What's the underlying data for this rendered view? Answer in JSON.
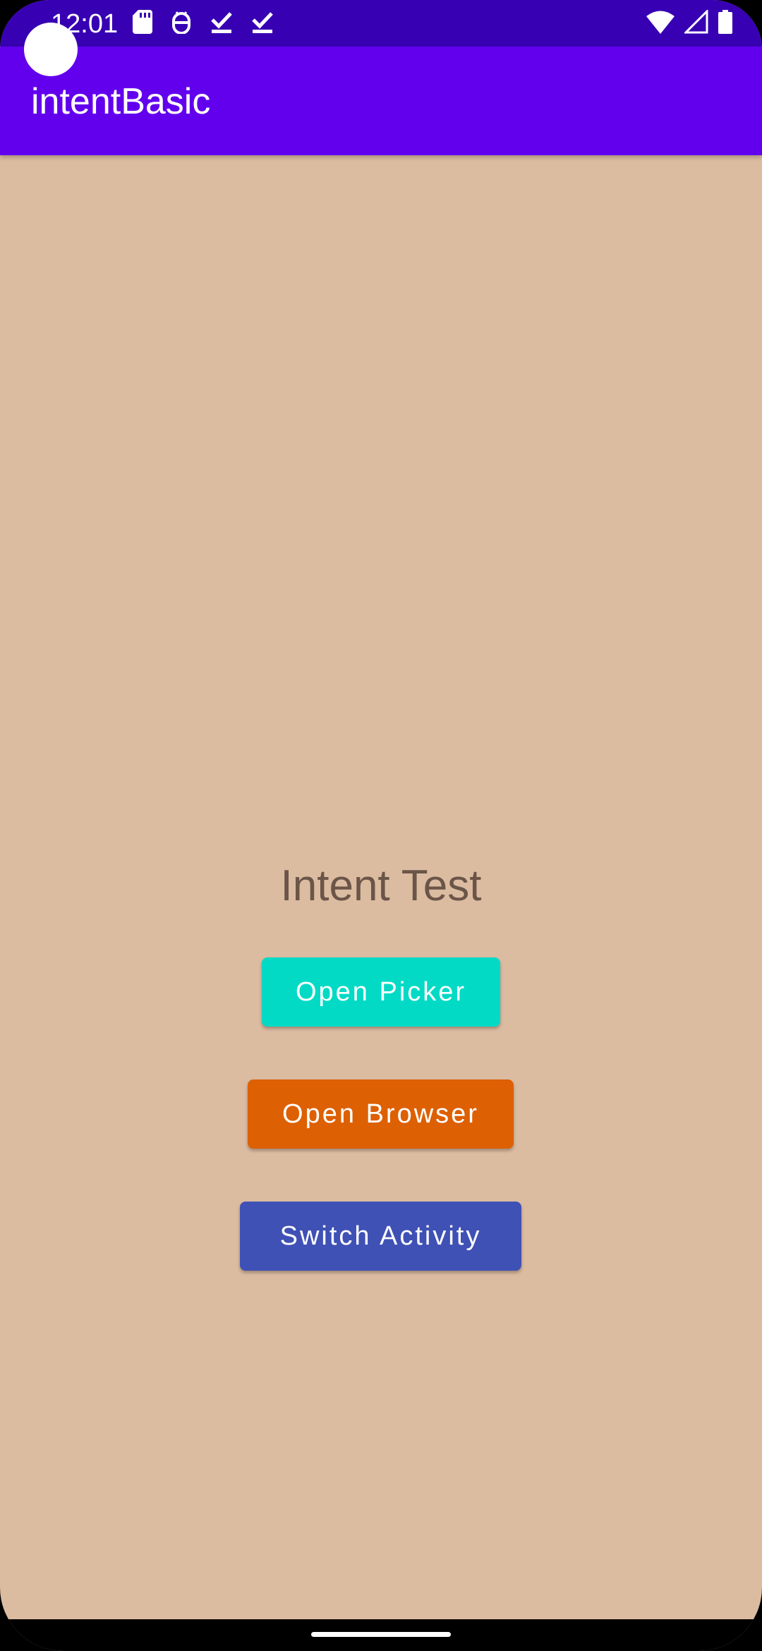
{
  "status_bar": {
    "time": "12:01",
    "icons_left": [
      "sd-card-icon",
      "android-debug-icon",
      "download-done-icon",
      "download-done-icon"
    ],
    "icons_right": [
      "wifi-icon",
      "cell-signal-icon",
      "battery-icon"
    ],
    "color": "#3700b3"
  },
  "app_bar": {
    "title": "intentBasic",
    "color": "#6200ee"
  },
  "main": {
    "heading": "Intent Test",
    "background": "#dcbca1",
    "buttons": [
      {
        "label": "Open Picker",
        "color": "#03dac5"
      },
      {
        "label": "Open Browser",
        "color": "#dd6003"
      },
      {
        "label": "Switch Activity",
        "color": "#3f51b5"
      }
    ]
  }
}
